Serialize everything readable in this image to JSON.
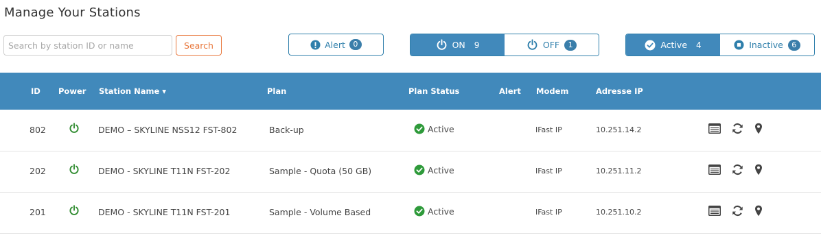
{
  "page": {
    "title": "Manage Your Stations"
  },
  "search": {
    "placeholder": "Search by station ID or name",
    "button_label": "Search"
  },
  "filters": {
    "alert": {
      "label": "Alert",
      "count": "0"
    },
    "power": {
      "on": {
        "label": "ON",
        "count": "9"
      },
      "off": {
        "label": "OFF",
        "count": "1"
      }
    },
    "plan": {
      "active": {
        "label": "Active",
        "count": "4"
      },
      "inactive": {
        "label": "Inactive",
        "count": "6"
      }
    }
  },
  "table": {
    "headers": {
      "id": "ID",
      "power": "Power",
      "station_name": "Station Name ▾",
      "plan": "Plan",
      "plan_status": "Plan Status",
      "alert": "Alert",
      "modem": "Modem",
      "ip": "Adresse IP"
    },
    "rows": [
      {
        "id": "802",
        "station_name": "DEMO – SKYLINE NSS12 FST-802",
        "plan": "Back-up",
        "plan_status": "Active",
        "alert": "",
        "modem": "IFast IP",
        "ip": "10.251.14.2"
      },
      {
        "id": "202",
        "station_name": "DEMO - SKYLINE T11N FST-202",
        "plan": "Sample - Quota (50 GB)",
        "plan_status": "Active",
        "alert": "",
        "modem": "IFast IP",
        "ip": "10.251.11.2"
      },
      {
        "id": "201",
        "station_name": "DEMO - SKYLINE T11N FST-201",
        "plan": "Sample - Volume Based",
        "plan_status": "Active",
        "alert": "",
        "modem": "IFast IP",
        "ip": "10.251.10.2"
      }
    ]
  },
  "colors": {
    "header_bg": "#4189bb",
    "accent": "#2f7fab",
    "search_orange": "#e8763a",
    "power_green": "#2e8b2e",
    "status_green": "#2e9a3a"
  },
  "icons": {
    "alert": "exclamation-circle-icon",
    "power": "power-icon",
    "active": "check-circle-icon",
    "inactive": "stop-circle-icon",
    "details": "list-card-icon",
    "refresh": "refresh-icon",
    "location": "map-pin-icon"
  }
}
